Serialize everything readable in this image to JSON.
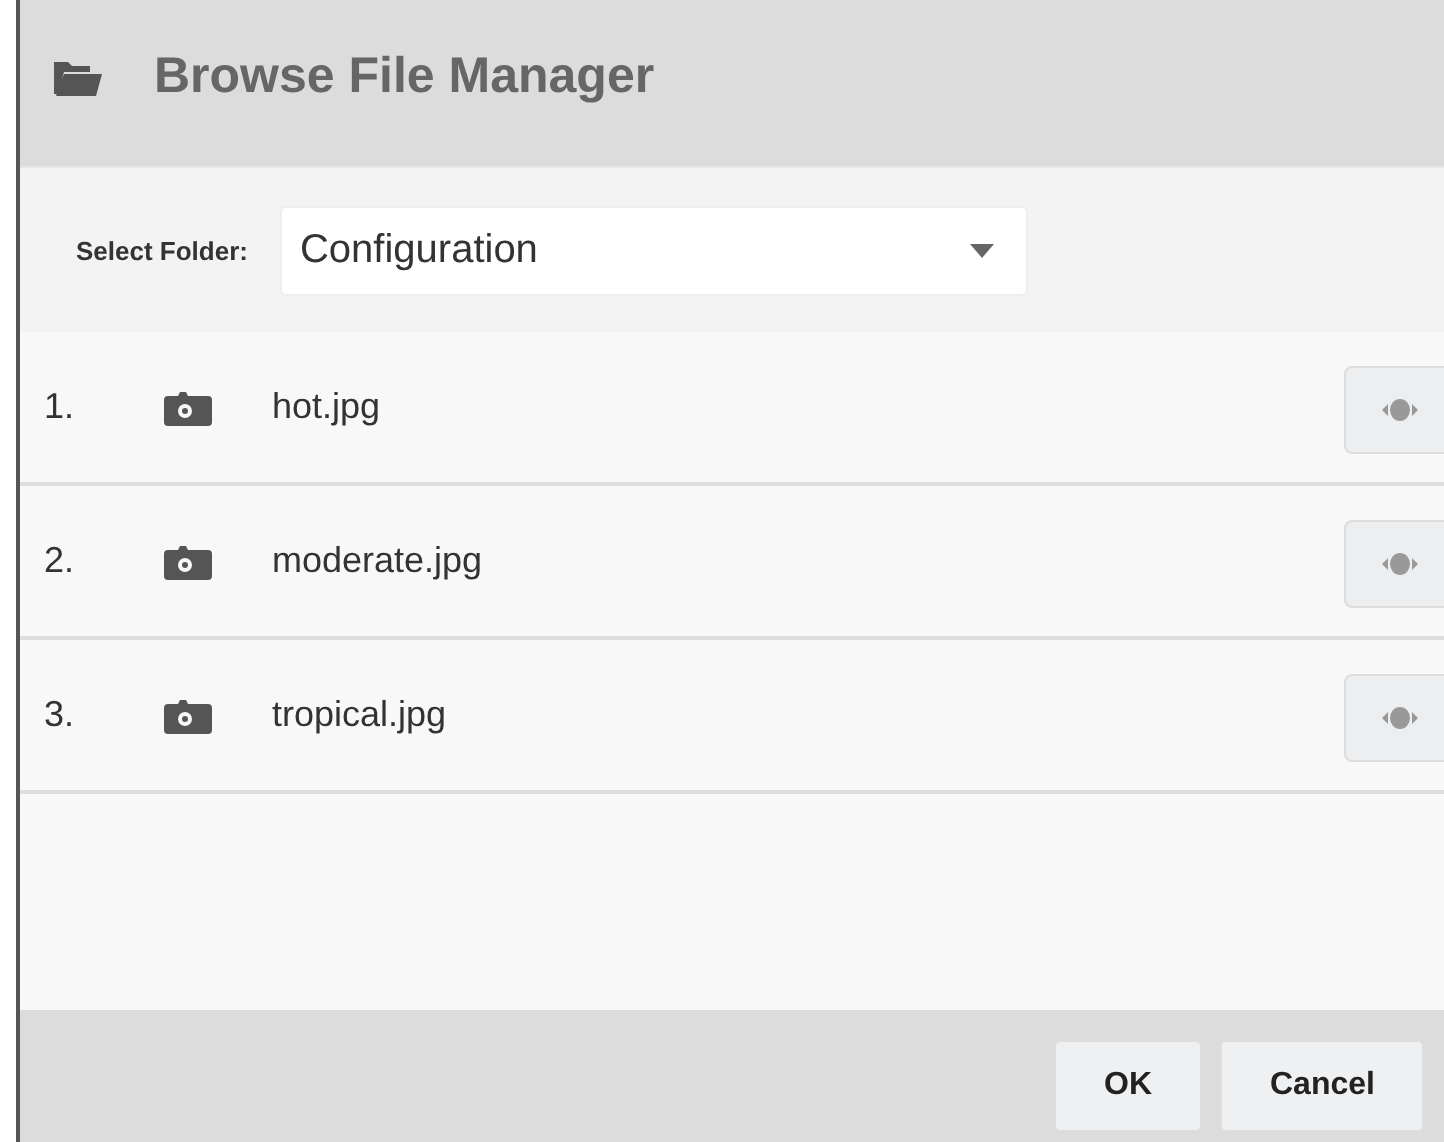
{
  "dialog": {
    "title": "Browse File Manager"
  },
  "folder": {
    "label": "Select Folder:",
    "value": "Configuration"
  },
  "files": [
    {
      "number": "1.",
      "name": "hot.jpg"
    },
    {
      "number": "2.",
      "name": "moderate.jpg"
    },
    {
      "number": "3.",
      "name": "tropical.jpg"
    }
  ],
  "buttons": [
    "OK",
    "Cancel"
  ]
}
